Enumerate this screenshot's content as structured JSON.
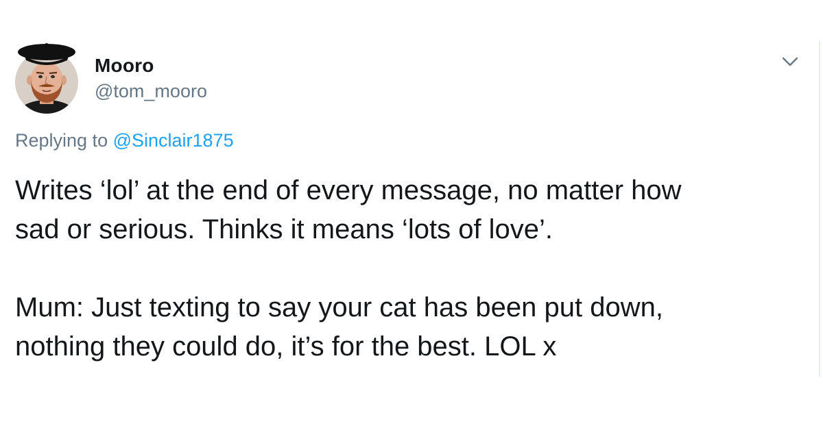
{
  "tweet": {
    "display_name": "Mooro",
    "handle": "@tom_mooro",
    "reply_prefix": "Replying to",
    "reply_to": "@Sinclair1875",
    "text_lines": [
      "Writes ‘lol’ at the end of every message, no matter how",
      "sad or serious. Thinks it means ‘lots of love’.",
      "Mum: Just texting to say your cat has been put down,",
      "nothing they could do, it’s for the best. LOL x"
    ],
    "menu_icon": "chevron-down-icon",
    "avatar_icon": "user-avatar"
  },
  "colors": {
    "text": "#14171a",
    "secondary": "#657786",
    "link": "#1da1f2",
    "background": "#ffffff"
  }
}
